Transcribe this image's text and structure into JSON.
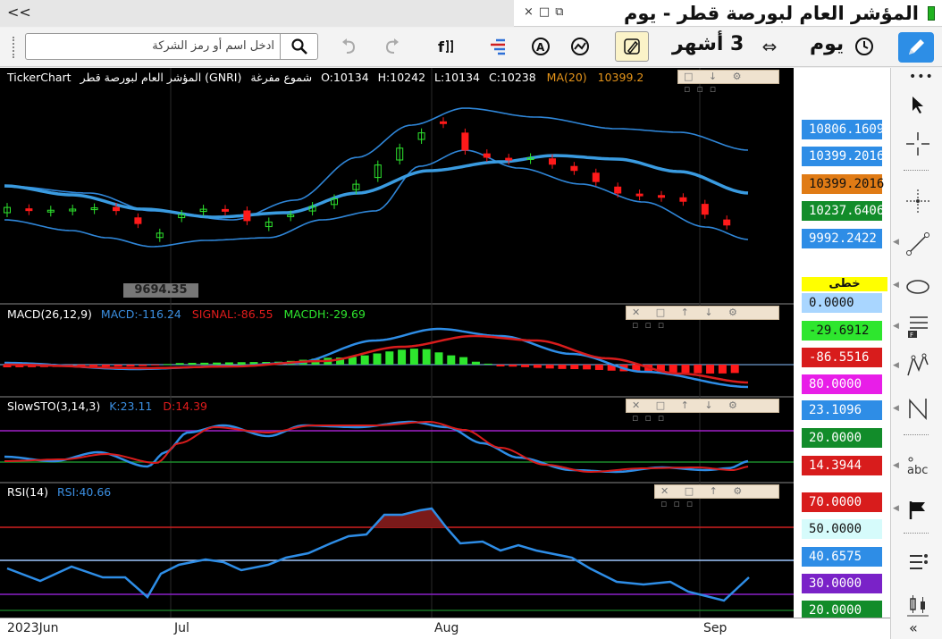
{
  "window": {
    "title": "المؤشر العام لبورصة قطر - يوم",
    "collapse_glyph": "<<",
    "controls": [
      "×",
      "□",
      "⧉"
    ]
  },
  "toolbar": {
    "search_placeholder": "ادخل اسم أو رمز الشركة",
    "period_label": "3 أشهر",
    "interval_label": "يوم"
  },
  "chart": {
    "header": {
      "vendor": "TickerChart",
      "symbol": "المؤشر العام لبورصة قطر (GNRI)",
      "candle_type": "شموع مفرغة",
      "open": "O:10134",
      "high": "H:10242",
      "low": "L:10134",
      "close": "C:10238",
      "ma_label": "MA(20)",
      "ma_value": "10399.2"
    },
    "low_marker": "9694.35",
    "price_tags": [
      "10806.1609",
      "10399.2016",
      "10399.2016",
      "10237.6406",
      "9992.2422"
    ],
    "line_tag": "خطى",
    "macd": {
      "title": "MACD(26,12,9)",
      "macd": "MACD:-116.24",
      "signal": "SIGNAL:-86.55",
      "hist": "MACDH:-29.69",
      "tags": [
        "0.0000",
        "-29.6912",
        "-86.5516",
        "80.0000"
      ]
    },
    "sto": {
      "title": "SlowSTO(3,14,3)",
      "k": "K:23.11",
      "d": "D:14.39",
      "tags": [
        "23.1096",
        "20.0000",
        "14.3944"
      ]
    },
    "rsi": {
      "title": "RSI(14)",
      "value": "RSI:40.66",
      "tags": [
        "70.0000",
        "50.0000",
        "40.6575",
        "30.0000",
        "20.0000"
      ]
    },
    "xaxis": [
      "2023Jun",
      "Jul",
      "Aug",
      "Sep"
    ]
  },
  "colors": {
    "up": "#2ee62e",
    "down": "#ff1a1a",
    "bands": "#2f86d8",
    "ma": "#3a9be0",
    "tag_blue": "#2e8de6",
    "tag_orange": "#e07b15",
    "tag_green": "#128c2a",
    "tag_red": "#d81c1c",
    "tag_magenta": "#e81ee8",
    "tag_purple": "#7a22c8",
    "tag_lightblue": "#a9d6ff",
    "tag_cyan": "#d6fbfb",
    "tag_yellow": "#ffff00"
  },
  "rightbar_icons": [
    "more-dots-icon",
    "cursor-arrow-icon",
    "crosshair-icon",
    "cross-dotted-icon",
    "trend-line-icon",
    "ellipse-icon",
    "fibonacci-icon",
    "pitchfork-icon",
    "zigzag-icon",
    "text-abc-icon",
    "flag-icon",
    "indicators-icon",
    "candles-icon"
  ]
}
